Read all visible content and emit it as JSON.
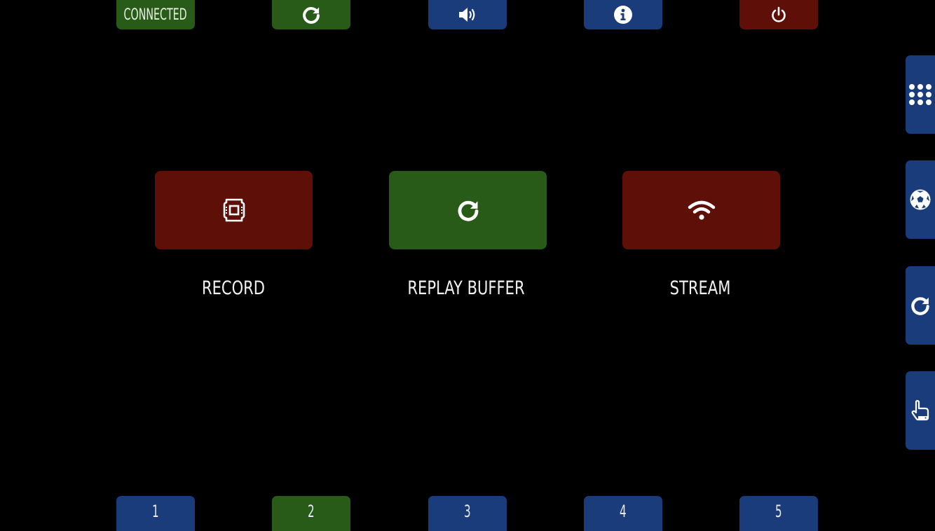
{
  "top_bar": {
    "status_label": "CONNECTED",
    "buttons": [
      {
        "icon": "refresh-icon"
      },
      {
        "icon": "volume-icon"
      },
      {
        "icon": "info-icon"
      },
      {
        "icon": "power-icon"
      }
    ]
  },
  "side_bar": {
    "buttons": [
      {
        "icon": "grid-icon"
      },
      {
        "icon": "soccer-ball-icon"
      },
      {
        "icon": "refresh-icon"
      },
      {
        "icon": "touch-hand-icon"
      }
    ]
  },
  "main": {
    "controls": [
      {
        "label": "RECORD",
        "icon": "film-icon",
        "state": "off"
      },
      {
        "label": "REPLAY BUFFER",
        "icon": "refresh-icon",
        "state": "on"
      },
      {
        "label": "STREAM",
        "icon": "wifi-icon",
        "state": "off"
      }
    ]
  },
  "bottom_bar": {
    "pages": [
      "1",
      "2",
      "3",
      "4",
      "5"
    ],
    "active_page": "2"
  },
  "colors": {
    "active_green": "#285a18",
    "inactive_red": "#5e1008",
    "nav_blue": "#1a3c7a",
    "background": "#000000"
  }
}
